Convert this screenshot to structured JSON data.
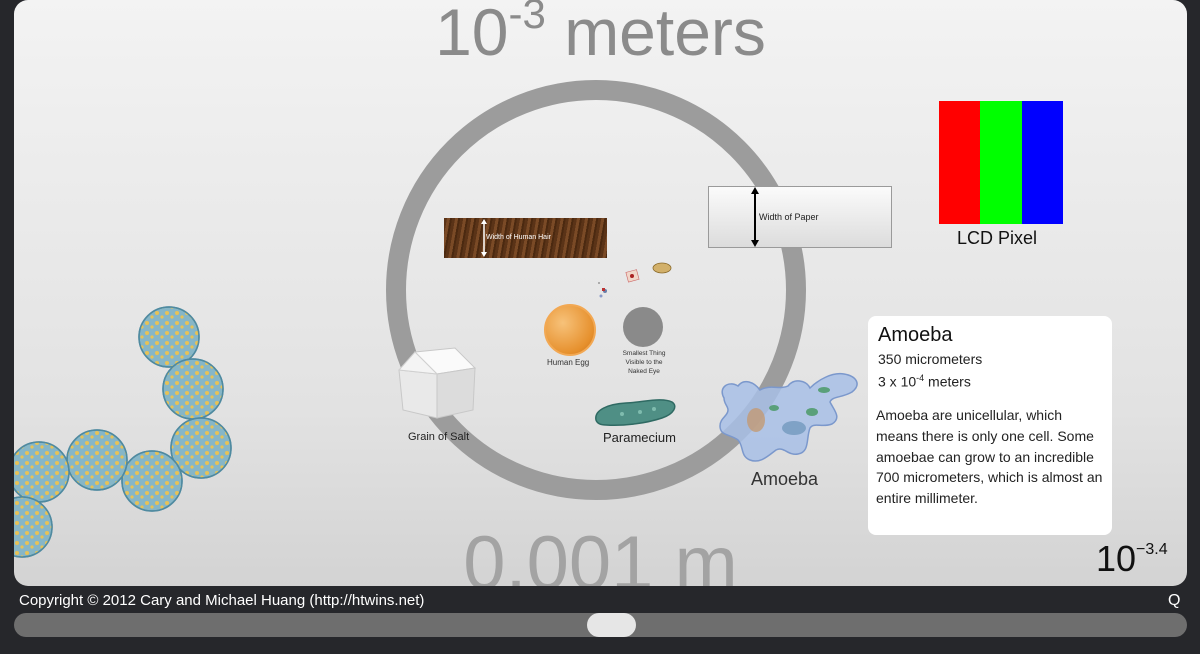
{
  "title": {
    "base": "10",
    "exponent": "-3",
    "unit": "meters"
  },
  "meter_text": "0.001 m",
  "objects": {
    "hair": "Width of Human Hair",
    "paper": "Width of Paper",
    "egg": "Human Egg",
    "smallest": "Smallest Thing Visible to the Naked Eye",
    "salt": "Grain of Salt",
    "paramecium": "Paramecium",
    "amoeba": "Amoeba",
    "lcd": "LCD Pixel"
  },
  "info": {
    "title": "Amoeba",
    "size": "350 micrometers",
    "meters_base": "3 x 10",
    "meters_exp": "-4",
    "meters_unit": " meters",
    "description": "Amoeba are unicellular, which means there is only one cell. Some amoebae can grow to an incredible 700 micrometers, which is almost an entire millimeter."
  },
  "scale": {
    "base": "10",
    "exponent": "−3.4"
  },
  "footer": {
    "copyright": "Copyright © 2012 Cary and Michael Huang (http://htwins.net)",
    "quality": "Q"
  },
  "slider": {
    "position_fraction": 0.51
  },
  "colors": {
    "background": "#26272b",
    "ring": "#9c9c9c",
    "pixel_red": "#ff0000",
    "pixel_green": "#00ff00",
    "pixel_blue": "#0000ff"
  },
  "icons": {
    "up_down_arrow": "arrow-icon"
  }
}
